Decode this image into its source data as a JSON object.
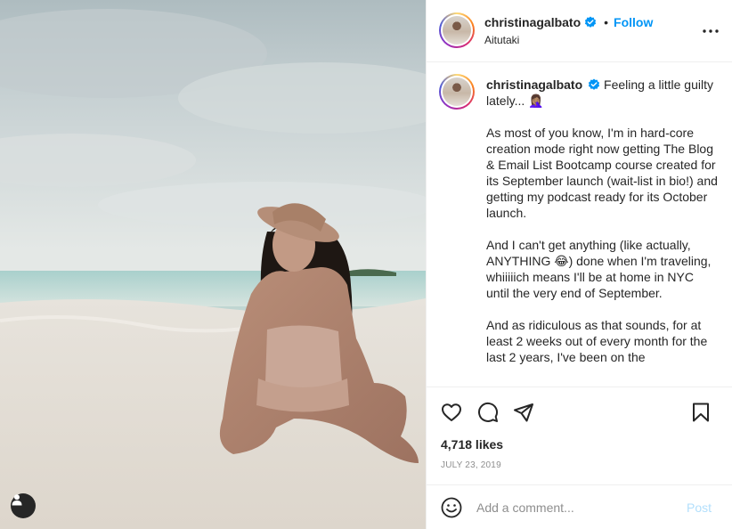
{
  "post": {
    "username": "christinagalbato",
    "location": "Aitutaki",
    "follow_label": "Follow",
    "separator": "•",
    "more_icon": "more-horizontal-icon",
    "caption": {
      "username": "christinagalbato",
      "p1": "Feeling a little guilty lately... 🤦🏽‍♀️",
      "p2": "As most of you know, I'm in hard-core creation mode right now getting The Blog & Email List Bootcamp course created for its September launch (wait-list in bio!) and getting my podcast ready for its October launch.",
      "p3": "And I can't get anything (like actually, ANYTHING 😂) done when I'm traveling, whiiiiich means I'll be at home in NYC until the very end of September.",
      "p4": "And as ridiculous as that sounds, for at least 2 weeks out of every month for the last 2 years, I've been on the"
    },
    "likes": "4,718 likes",
    "date": "JULY 23, 2019",
    "comment_placeholder": "Add a comment...",
    "post_label": "Post",
    "icons": {
      "like": "heart-icon",
      "comment": "comment-icon",
      "share": "paper-plane-icon",
      "save": "bookmark-icon",
      "emoji": "smiley-icon",
      "tag": "user-tag-icon",
      "verified": "verified-badge-icon"
    },
    "colors": {
      "accent": "#0095f6",
      "text": "#262626",
      "muted": "#8e8e8e",
      "post_disabled": "#b2dffc",
      "border": "#efefef"
    }
  }
}
